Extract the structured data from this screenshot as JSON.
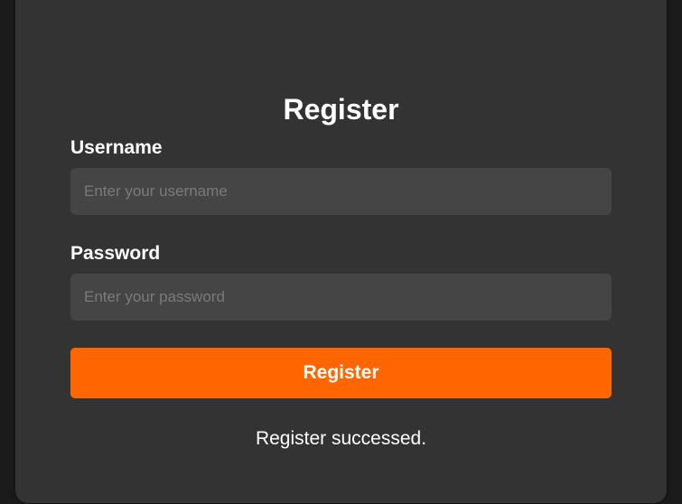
{
  "form": {
    "title": "Register",
    "username_label": "Username",
    "username_placeholder": "Enter your username",
    "username_value": "",
    "password_label": "Password",
    "password_placeholder": "Enter your password",
    "password_value": "",
    "submit_label": "Register",
    "status_message": "Register successed."
  },
  "colors": {
    "page_background": "#1b1b1b",
    "card_background": "#333333",
    "input_background": "#454545",
    "accent": "#ff6600",
    "text": "#ffffff",
    "placeholder": "#7a7a7a"
  }
}
